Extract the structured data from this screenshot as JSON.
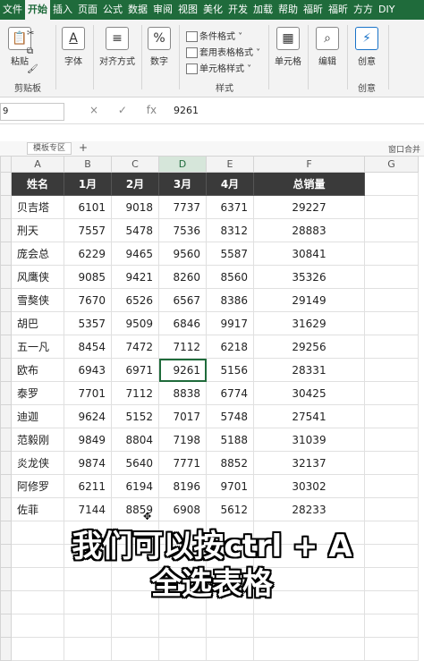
{
  "ribbon_tabs": [
    "文件",
    "开始",
    "插入",
    "页面",
    "公式",
    "数据",
    "审阅",
    "视图",
    "美化",
    "开发",
    "加载",
    "帮助",
    "福昕",
    "福昕",
    "方方",
    "DIY"
  ],
  "active_tab_index": 1,
  "ribbon": {
    "clipboard": {
      "paste_label": "粘贴",
      "label": "剪贴板"
    },
    "font_label": "字体",
    "align_label": "对齐方式",
    "number_label": "数字",
    "styles": {
      "items": [
        "条件格式 ˅",
        "套用表格格式 ˅",
        "单元格样式 ˅"
      ],
      "label": "样式"
    },
    "cells_label": "单元格",
    "edit_label": "编辑",
    "create": {
      "btn_label": "创意",
      "label": "创意"
    }
  },
  "formula_bar": {
    "name_box": "9",
    "value": "9261",
    "icons": [
      "×",
      "✓",
      "fx"
    ]
  },
  "sheet_bar": {
    "tab": "模板专区",
    "plus": "+",
    "right_text": "窗口合并"
  },
  "columns": [
    "A",
    "B",
    "C",
    "D",
    "E",
    "F",
    "G"
  ],
  "selected_column": "D",
  "table": {
    "headers": [
      "姓名",
      "1月",
      "2月",
      "3月",
      "4月",
      "总销量"
    ],
    "rows": [
      [
        "贝吉塔",
        "6101",
        "9018",
        "7737",
        "6371",
        "29227"
      ],
      [
        "刑天",
        "7557",
        "5478",
        "7536",
        "8312",
        "28883"
      ],
      [
        "庞会总",
        "6229",
        "9465",
        "9560",
        "5587",
        "30841"
      ],
      [
        "风鹰侠",
        "9085",
        "9421",
        "8260",
        "8560",
        "35326"
      ],
      [
        "雪獒侠",
        "7670",
        "6526",
        "6567",
        "8386",
        "29149"
      ],
      [
        "胡巴",
        "5357",
        "9509",
        "6846",
        "9917",
        "31629"
      ],
      [
        "五一凡",
        "8454",
        "7472",
        "7112",
        "6218",
        "29256"
      ],
      [
        "欧布",
        "6943",
        "6971",
        "9261",
        "5156",
        "28331"
      ],
      [
        "泰罗",
        "7701",
        "7112",
        "8838",
        "6774",
        "30425"
      ],
      [
        "迪迦",
        "9624",
        "5152",
        "7017",
        "5748",
        "27541"
      ],
      [
        "范毅刚",
        "9849",
        "8804",
        "7198",
        "5188",
        "31039"
      ],
      [
        "炎龙侠",
        "9874",
        "5640",
        "7771",
        "8852",
        "32137"
      ],
      [
        "阿修罗",
        "6211",
        "6194",
        "8196",
        "9701",
        "30302"
      ],
      [
        "佐菲",
        "7144",
        "8859",
        "6908",
        "5612",
        "28233"
      ]
    ]
  },
  "selected_cell": {
    "row": 7,
    "col": 3
  },
  "empty_rows": 6,
  "subtitle_lines": [
    "我们可以按ctrl + A",
    "全选表格"
  ]
}
